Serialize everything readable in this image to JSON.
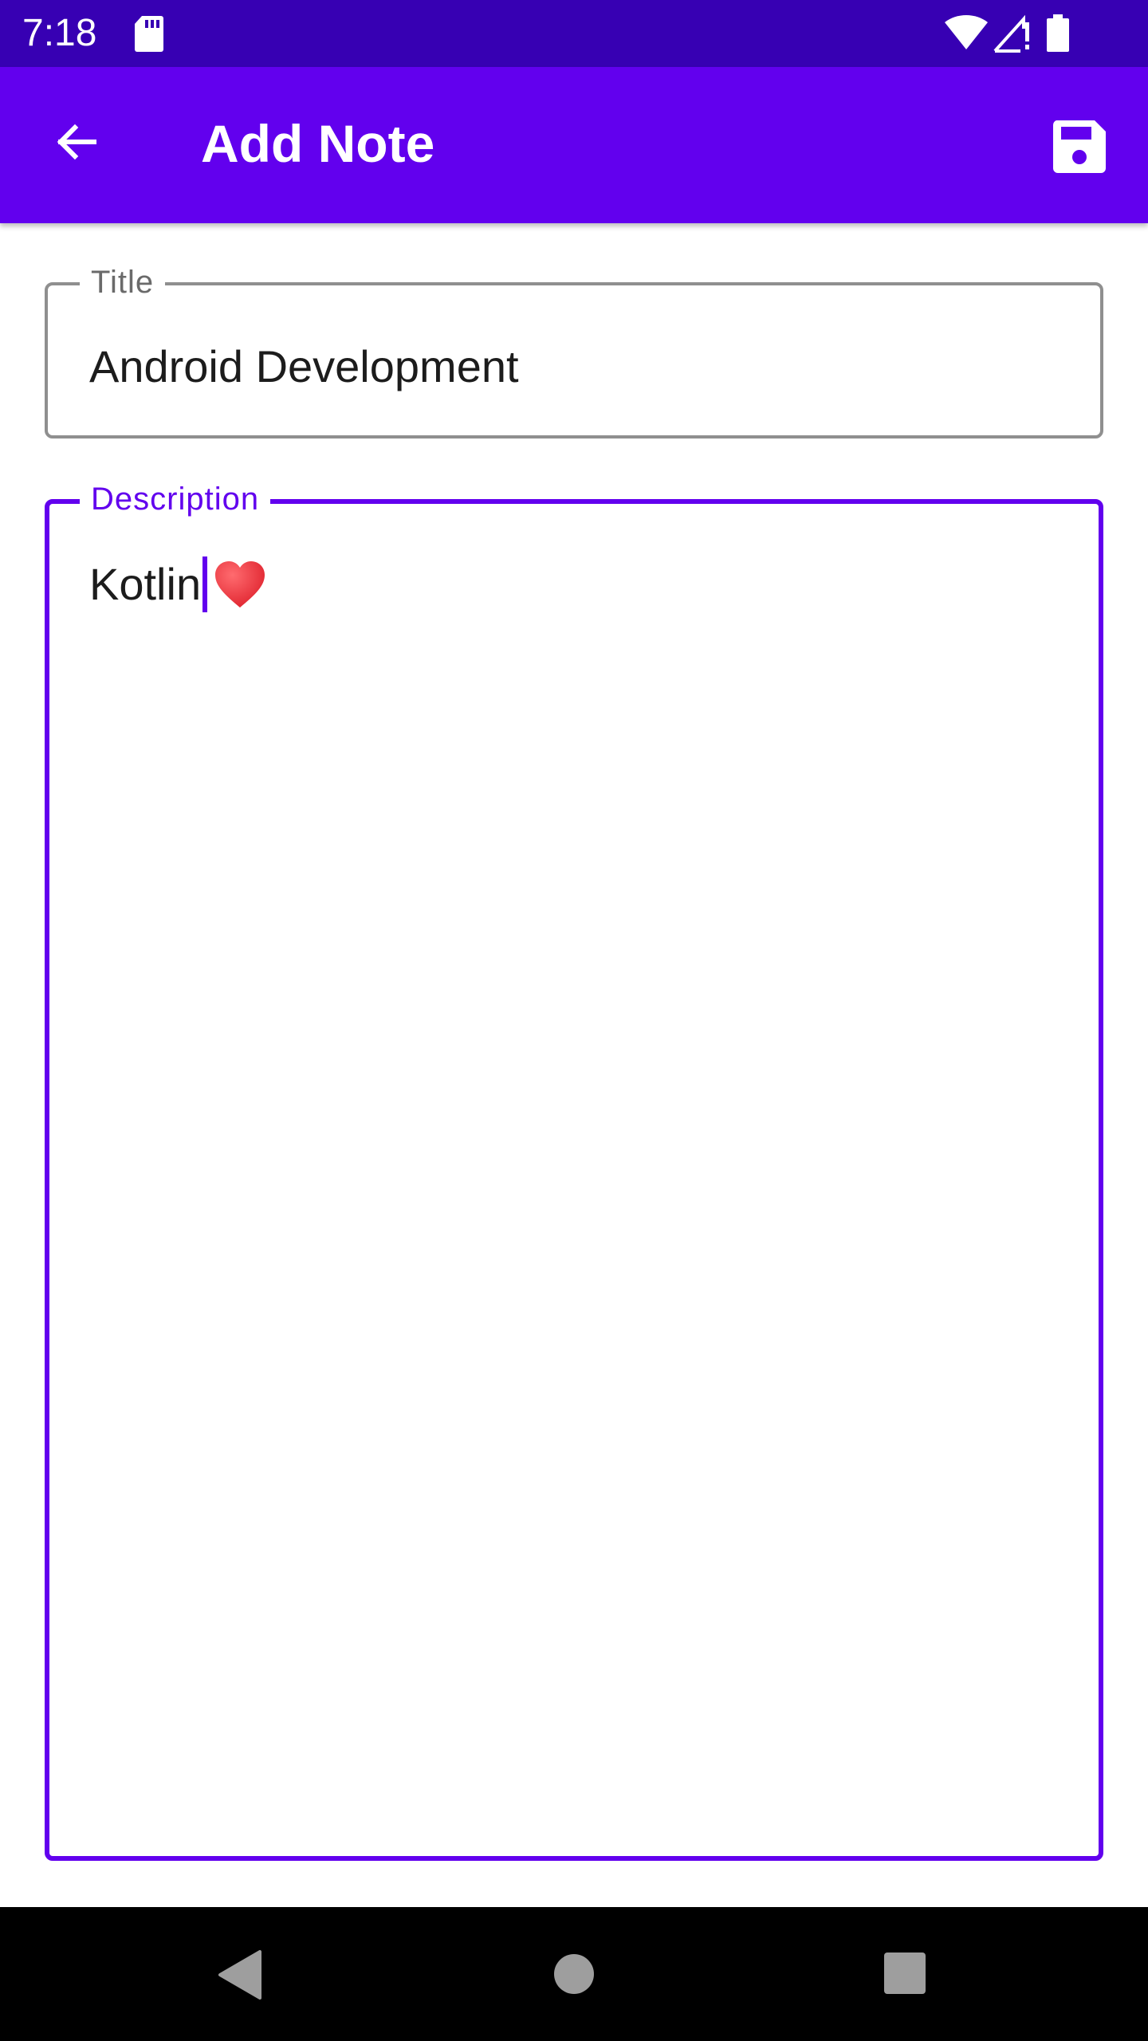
{
  "status_bar": {
    "time": "7:18",
    "icons": [
      "sd-card-icon",
      "wifi-icon",
      "signal-icon",
      "battery-icon"
    ]
  },
  "app_bar": {
    "title": "Add Note",
    "back_icon": "arrow-back-icon",
    "save_icon": "save-icon"
  },
  "form": {
    "title_field": {
      "label": "Title",
      "value": "Android Development"
    },
    "description_field": {
      "label": "Description",
      "value": "Kotlin",
      "emoji": "heart-icon",
      "focused": true
    }
  },
  "navigation_bar": {
    "buttons": [
      "nav-back-icon",
      "nav-home-icon",
      "nav-recents-icon"
    ]
  },
  "colors": {
    "status_bar": "#3700b3",
    "primary": "#6200ee",
    "outline": "#8f8f8f",
    "heart": "#e8323c"
  }
}
